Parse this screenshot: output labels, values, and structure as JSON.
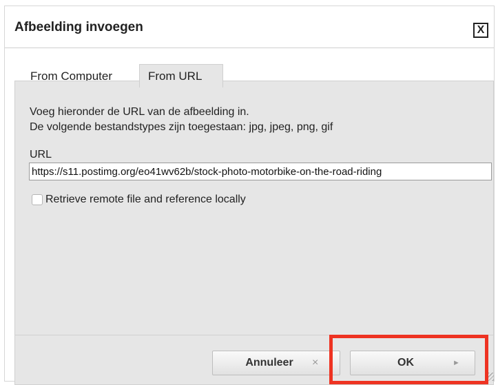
{
  "dialog": {
    "title": "Afbeelding invoegen",
    "close_label": "X"
  },
  "tabs": [
    {
      "label": "From Computer",
      "active": false
    },
    {
      "label": "From URL",
      "active": true
    }
  ],
  "panel": {
    "description_line1": "Voeg hieronder de URL van de afbeelding in.",
    "description_line2": "De volgende bestandstypes zijn toegestaan: jpg, jpeg, png, gif",
    "url_label": "URL",
    "url_value": "https://s11.postimg.org/eo41wv62b/stock-photo-motorbike-on-the-road-riding",
    "checkbox_label": "Retrieve remote file and reference locally",
    "checkbox_checked": false
  },
  "buttons": {
    "cancel_label": "Annuleer",
    "cancel_icon": "×",
    "cancel_icon_name": "close-small-icon",
    "ok_label": "OK",
    "ok_icon": "►",
    "ok_icon_name": "play-arrow-icon"
  },
  "colors": {
    "panel_bg": "#e6e6e6",
    "highlight": "#ee3322"
  }
}
